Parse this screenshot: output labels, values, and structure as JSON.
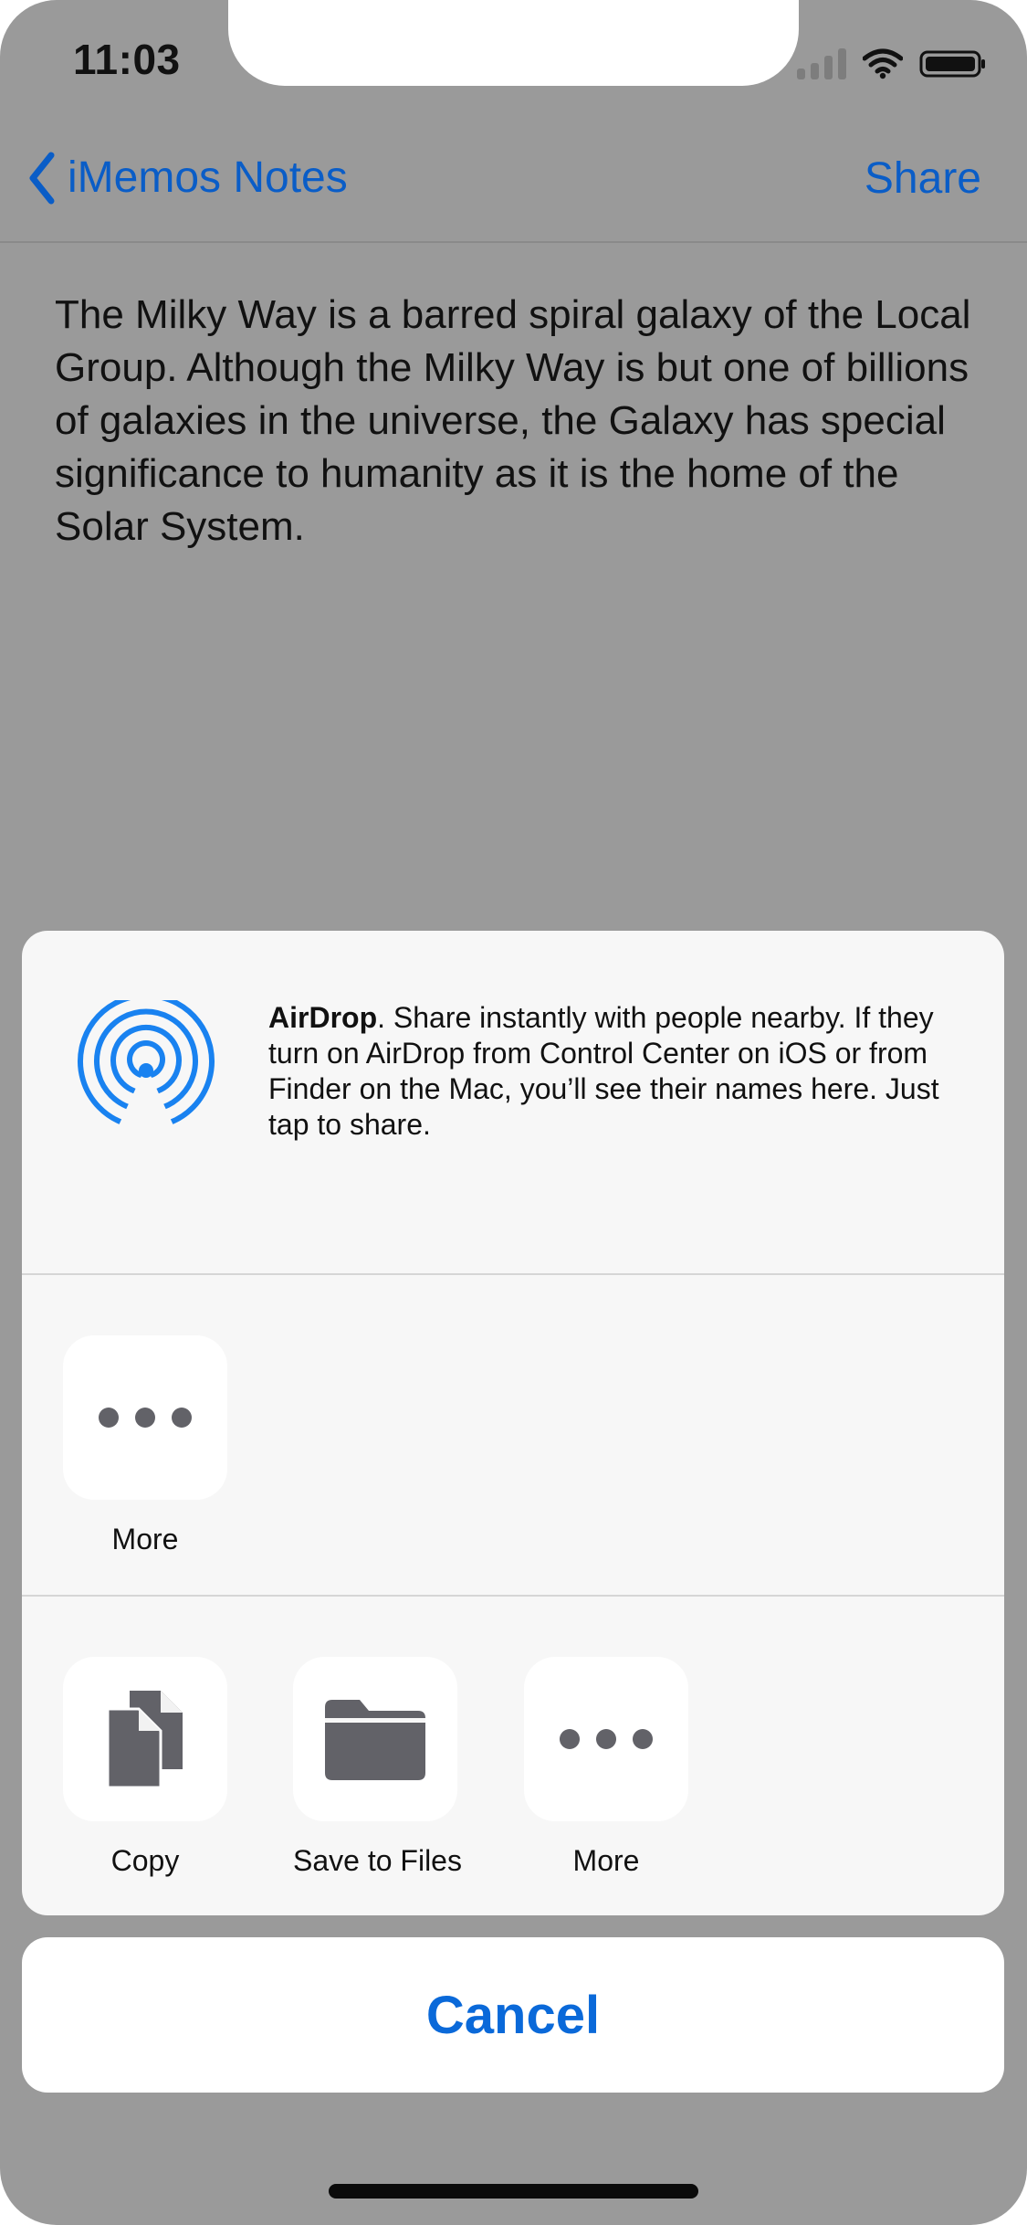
{
  "status_bar": {
    "time": "11:03",
    "signal_icon": "cellular-signal-icon",
    "wifi_icon": "wifi-icon",
    "battery_icon": "battery-icon"
  },
  "nav": {
    "back_label": "iMemos Notes",
    "share_label": "Share",
    "accent_color": "#0a5dc7"
  },
  "note": {
    "text": "The Milky Way is a barred spiral galaxy of the Local Group. Although the Milky Way is but one of billions of galaxies in the universe, the Galaxy has special significance to humanity as it is the home of the Solar System."
  },
  "share_sheet": {
    "airdrop": {
      "icon": "airdrop-icon",
      "title": "AirDrop",
      "description": ". Share instantly with people nearby. If they turn on AirDrop from Control Center on iOS or from Finder on the Mac, you’ll see their names here. Just tap to share."
    },
    "app_row": [
      {
        "label": "More",
        "icon": "more-icon"
      }
    ],
    "action_row": [
      {
        "label": "Copy",
        "icon": "copy-icon"
      },
      {
        "label": "Save to Files",
        "icon": "folder-icon"
      },
      {
        "label": "More",
        "icon": "more-icon"
      }
    ]
  },
  "cancel": {
    "label": "Cancel",
    "color": "#0a69d9"
  }
}
